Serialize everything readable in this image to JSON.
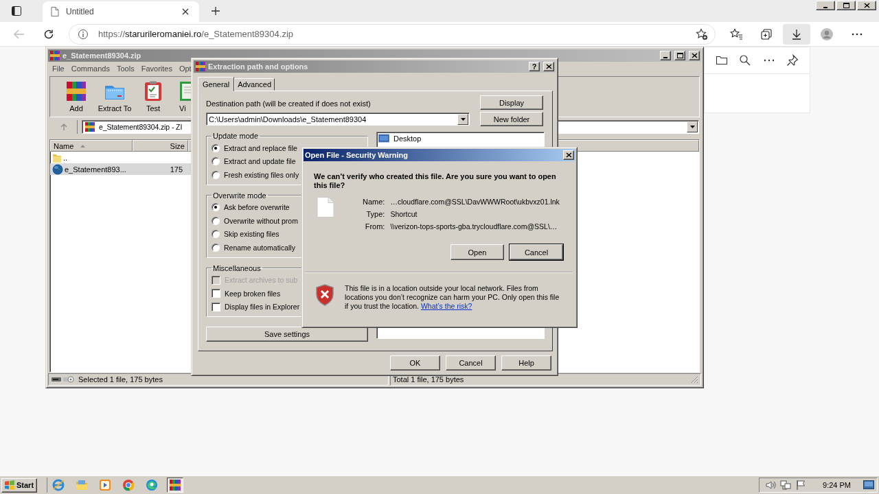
{
  "browser": {
    "tabs": [
      {
        "title": "Untitled",
        "selected": true
      }
    ],
    "address": {
      "url": "https://**starurileromaniei.ro**/e_Statement89304.zip"
    },
    "toolbar": [
      {
        "kind": "favorites",
        "selected": false
      },
      {
        "kind": "collections",
        "selected": false
      },
      {
        "kind": "downloads",
        "selected": true
      },
      {
        "kind": "profile",
        "selected": false
      },
      {
        "kind": "more",
        "selected": false
      }
    ]
  },
  "winrar": {
    "title": "e_Statement89304.zip",
    "menu": [
      "File",
      "Commands",
      "Tools",
      "Favorites",
      "Opt"
    ],
    "toolbar": [
      {
        "kind": "add",
        "label": "Add"
      },
      {
        "kind": "extract",
        "label": "Extract To"
      },
      {
        "kind": "test",
        "label": "Test"
      },
      {
        "kind": "view",
        "label": "Vi"
      }
    ],
    "address": "e_Statement89304.zip - ZI",
    "columns": [
      "Name",
      "Size"
    ],
    "rows": [
      {
        "kind": "folder",
        "name": "..",
        "selected": false
      },
      {
        "kind": "file",
        "name": "e_Statement893...",
        "size": "175",
        "selected": true
      }
    ],
    "status": {
      "selection": "Selected 1 file, 175 bytes",
      "total": "Total 1 file, 175 bytes"
    }
  },
  "extract_dialog": {
    "title": "Extraction path and options",
    "help_button": "?",
    "tabs": [
      {
        "label": "General",
        "selected": true
      },
      {
        "label": "Advanced",
        "selected": false
      }
    ],
    "destination_label": "Destination path (will be created if does not exist)",
    "destination_path": "C:\\Users\\admin\\Downloads\\e_Statement89304",
    "side_buttons": [
      "Display",
      "New folder"
    ],
    "groups": [
      {
        "title": "Update mode",
        "options": [
          {
            "kind": "radio",
            "label": "Extract and replace file",
            "selected": true
          },
          {
            "kind": "radio",
            "label": "Extract and update file",
            "selected": false
          },
          {
            "kind": "radio",
            "label": "Fresh existing files only",
            "selected": false
          }
        ]
      },
      {
        "title": "Overwrite mode",
        "options": [
          {
            "kind": "radio",
            "label": "Ask before overwrite",
            "selected": true
          },
          {
            "kind": "radio",
            "label": "Overwrite without prom",
            "selected": false
          },
          {
            "kind": "radio",
            "label": "Skip existing files",
            "selected": false
          },
          {
            "kind": "radio",
            "label": "Rename automatically",
            "selected": false
          }
        ]
      },
      {
        "title": "Miscellaneous",
        "options": [
          {
            "kind": "checkbox",
            "label": "Extract archives to sub",
            "checked": false,
            "disabled": true
          },
          {
            "kind": "checkbox",
            "label": "Keep broken files",
            "checked": false,
            "disabled": false
          },
          {
            "kind": "checkbox",
            "label": "Display files in Explorer",
            "checked": false,
            "disabled": false
          }
        ]
      }
    ],
    "save_button": "Save settings",
    "folders": [
      {
        "label": "Desktop"
      }
    ],
    "buttons": [
      "OK",
      "Cancel",
      "Help"
    ]
  },
  "security_dialog": {
    "title": "Open File - Security Warning",
    "heading": "We can’t verify who created this file. Are you sure you want to open this file?",
    "fields": [
      {
        "label": "Name:",
        "value": "…cloudflare.com@SSL\\DavWWWRoot\\ukbvxz01.lnk"
      },
      {
        "label": "Type:",
        "value": "Shortcut"
      },
      {
        "label": "From:",
        "value": "\\\\verizon-tops-sports-gba.trycloudflare.com@SSL\\…"
      }
    ],
    "buttons": [
      {
        "label": "Open",
        "default": false
      },
      {
        "label": "Cancel",
        "default": true
      }
    ],
    "notice": "This file is in a location outside your local network. Files from locations you don’t recognize can harm your PC. Only open this file if you trust the location.",
    "link": "What’s the risk?"
  },
  "taskbar": {
    "start": "Start",
    "apps": [
      {
        "kind": "ie",
        "active": false
      },
      {
        "kind": "explorer",
        "active": false
      },
      {
        "kind": "media",
        "active": false
      },
      {
        "kind": "chrome",
        "active": false
      },
      {
        "kind": "edge",
        "active": false
      },
      {
        "kind": "winrar",
        "active": true
      }
    ],
    "clock": "9:24 PM"
  }
}
